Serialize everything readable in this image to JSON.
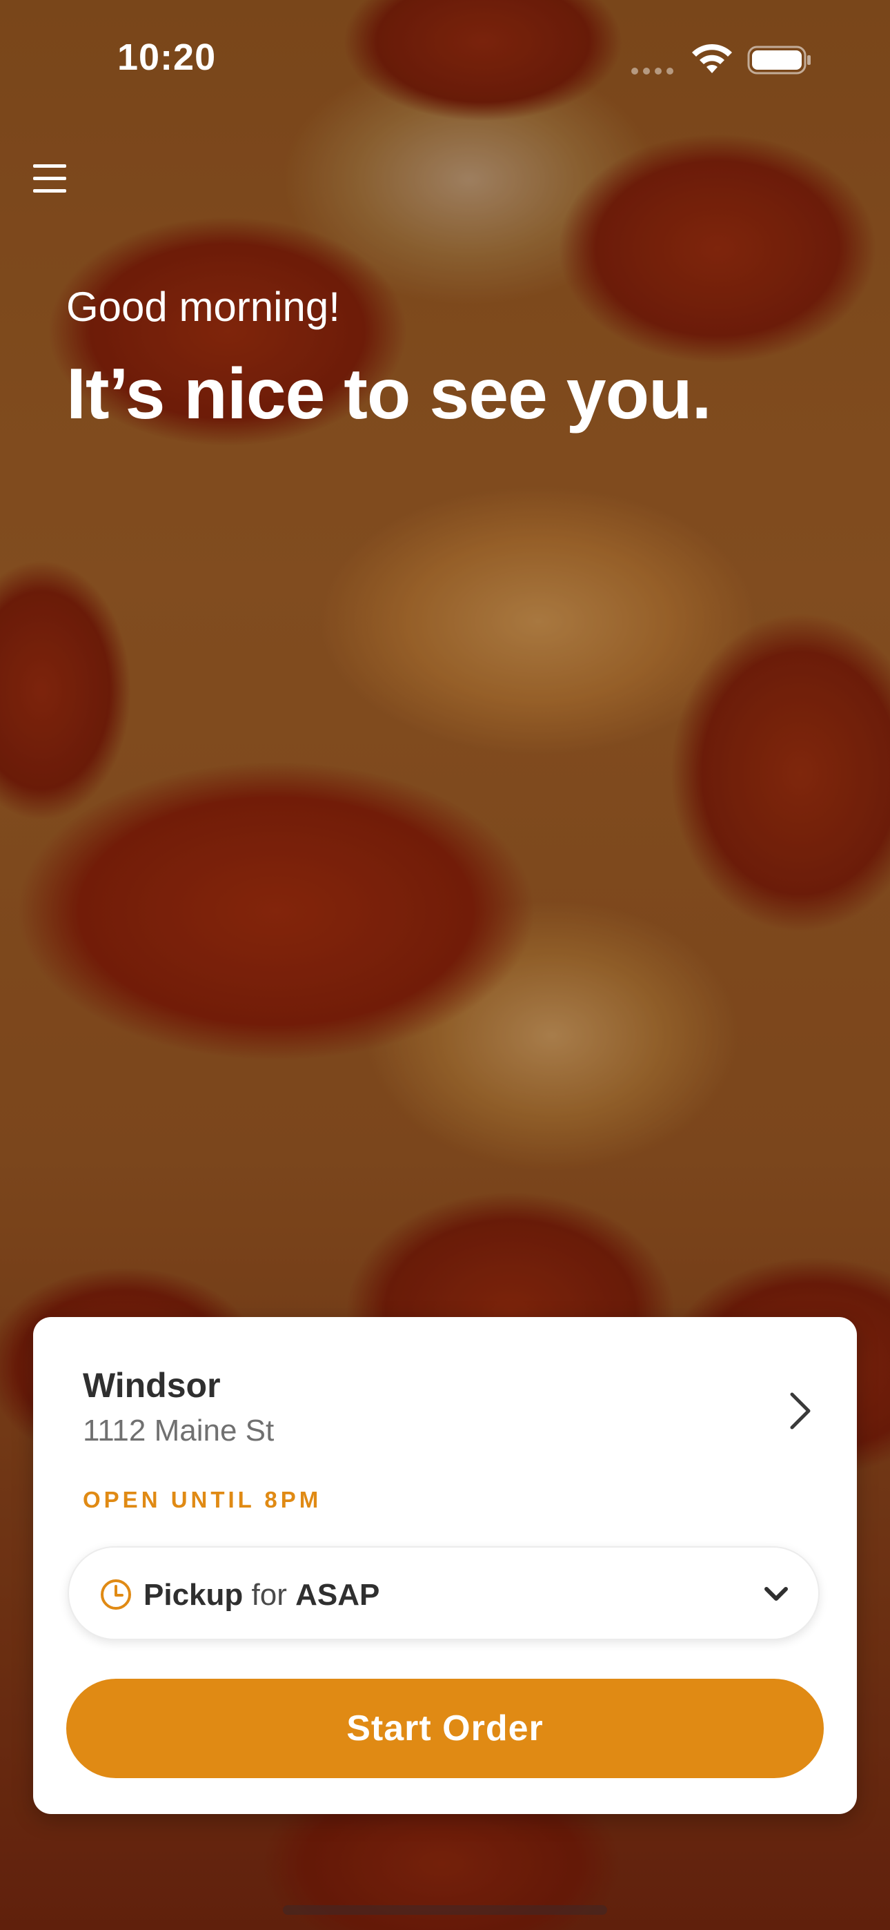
{
  "status_bar": {
    "time": "10:20"
  },
  "menu": {
    "icon": "hamburger-menu-icon"
  },
  "greeting": {
    "subtitle": "Good morning!",
    "headline": "It’s nice to see you."
  },
  "store": {
    "name": "Windsor",
    "address": "1112 Maine St",
    "hours": "OPEN UNTIL 8PM"
  },
  "order_mode": {
    "mode": "Pickup",
    "connector": "for",
    "time": "ASAP"
  },
  "actions": {
    "start_order": "Start Order"
  },
  "colors": {
    "accent": "#e08a14",
    "card": "#ffffff",
    "text_primary": "#2f2f2f",
    "text_secondary": "#707070"
  }
}
